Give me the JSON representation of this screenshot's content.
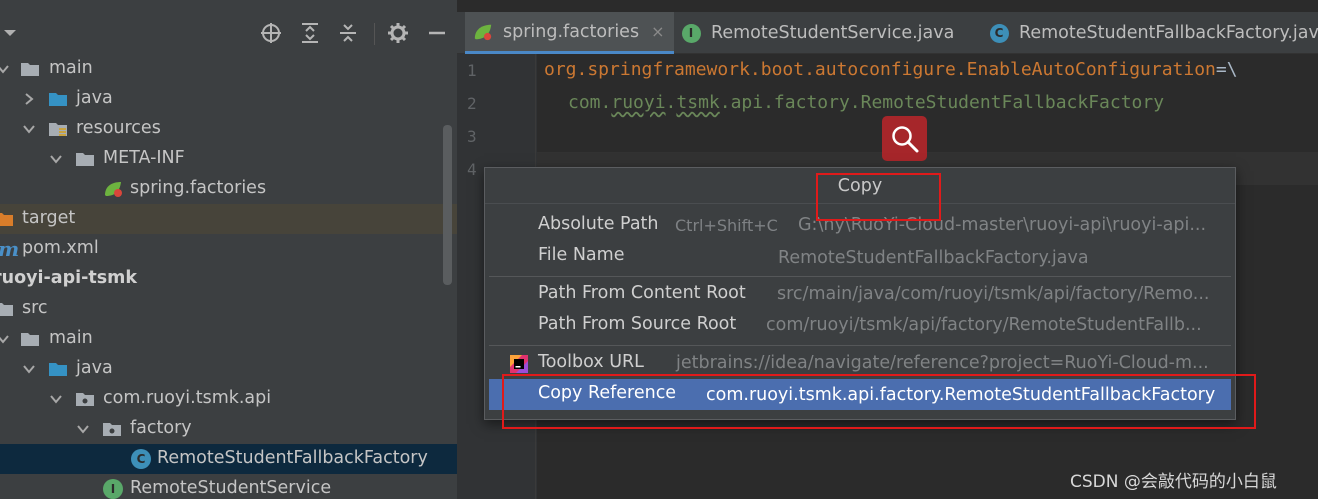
{
  "project_tree": {
    "rows": [
      {
        "label": "main"
      },
      {
        "label": "java"
      },
      {
        "label": "resources"
      },
      {
        "label": "META-INF"
      },
      {
        "label": "spring.factories"
      },
      {
        "label": "target"
      },
      {
        "label": "pom.xml"
      },
      {
        "label": "ruoyi-api-tsmk"
      },
      {
        "label": "src"
      },
      {
        "label": "main"
      },
      {
        "label": "java"
      },
      {
        "label": "com.ruoyi.tsmk.api"
      },
      {
        "label": "factory"
      },
      {
        "label": "RemoteStudentFallbackFactory"
      },
      {
        "label": "RemoteStudentService"
      }
    ]
  },
  "toolbar": {
    "icons": [
      "crosshair-icon",
      "expand-all-icon",
      "collapse-all-icon",
      "gear-icon",
      "minimize-icon"
    ]
  },
  "tabs": [
    {
      "label": "spring.factories",
      "close": "×"
    },
    {
      "label": "RemoteStudentService.java",
      "badge": "I"
    },
    {
      "label": "RemoteStudentFallbackFactory.java",
      "badge": "C"
    }
  ],
  "editor": {
    "line_numbers": [
      "1",
      "2",
      "3",
      "4"
    ],
    "line1_key": "org.springframework.boot.autoconfigure.EnableAutoConfiguration",
    "line1_eq": "=\\",
    "line2_pre": "com.",
    "line2_typo": "ruoyi",
    "line2_mid": ".",
    "line2_typo2": "tsmk",
    "line2_post": ".api.factory.RemoteStudentFallbackFactory"
  },
  "popup": {
    "title": "Copy",
    "items": [
      {
        "label": "Absolute Path",
        "shortcut": "Ctrl+Shift+C",
        "value": "G:\\ny\\RuoYi-Cloud-master\\ruoyi-api\\ruoyi-api..."
      },
      {
        "label": "File Name",
        "value": "RemoteStudentFallbackFactory.java"
      },
      {
        "label": "Path From Content Root",
        "value": "src/main/java/com/ruoyi/tsmk/api/factory/Remo..."
      },
      {
        "label": "Path From Source Root",
        "value": "com/ruoyi/tsmk/api/factory/RemoteStudentFallb..."
      },
      {
        "label": "Toolbox URL",
        "value": "jetbrains://idea/navigate/reference?project=RuoYi-Cloud-m..."
      },
      {
        "label": "Copy Reference",
        "value": "com.ruoyi.tsmk.api.factory.RemoteStudentFallbackFactory"
      }
    ]
  },
  "watermark": "CSDN @会敲代码的小白鼠",
  "colors": {
    "accent_selection": "#4b6eaf",
    "annotation_red": "#e01a1a",
    "find_button": "#a6262a"
  }
}
